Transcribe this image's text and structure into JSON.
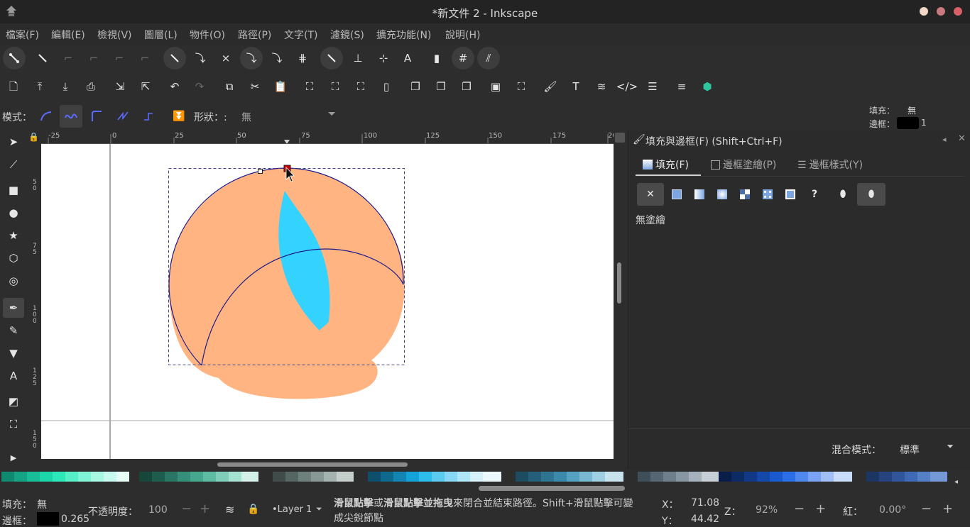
{
  "window": {
    "title": "*新文件 2 - Inkscape"
  },
  "menu": [
    "檔案(F)",
    "編輯(E)",
    "檢視(V)",
    "圖層(L)",
    "物件(O)",
    "路徑(P)",
    "文字(T)",
    "濾鏡(S)",
    "擴充功能(N)",
    "說明(H)"
  ],
  "ctrl": {
    "mode_label": "模式：",
    "shape_label": "形狀：:",
    "shape_value": "無",
    "fill_label": "填充：",
    "fill_value": "無",
    "stroke_label": "邊框：",
    "stroke_width": "1"
  },
  "ruler": {
    "top_ticks": [
      "-25",
      "0",
      "25",
      "50",
      "75",
      "100",
      "125",
      "150",
      "175",
      "20"
    ],
    "left_ticks": [
      "5",
      "0",
      "7",
      "5",
      "1",
      "0",
      "0",
      "1",
      "2",
      "5",
      "1",
      "5",
      "0"
    ]
  },
  "dock": {
    "title": "填充與邊框(F) (Shift+Ctrl+F)",
    "tabs": [
      "填充(F)",
      "邊框塗繪(P)",
      "邊框樣式(Y)"
    ],
    "paint_state": "無塗繪",
    "blend_label": "混合模式：",
    "blend_value": "標準"
  },
  "status": {
    "fill_label": "填充：",
    "fill_value": "無",
    "stroke_label": "邊框：",
    "stroke_value": "0.265",
    "opacity_label": "不透明度：",
    "opacity_value": "100",
    "layer": "•Layer 1",
    "message_line1_a": "滑鼠點擊",
    "message_line1_b": "或",
    "message_line1_c": "滑鼠點擊並拖曳",
    "message_line1_d": "來閉合並結束路徑。Shift+滑鼠點擊可變",
    "message_line2": "成尖銳節點",
    "x_label": "X：",
    "x_value": "71.08",
    "y_label": "Y：",
    "y_value": "44.42",
    "zoom_label": "Z：",
    "zoom_value": "92%",
    "rotate_label": "紅：",
    "rotate_value": "0.00°"
  },
  "colors": {
    "shape_fill": "#ffb482",
    "lens_fill": "#33d2ff",
    "path_stroke": "#1a1a8c",
    "node_selected": "#cc0000"
  }
}
